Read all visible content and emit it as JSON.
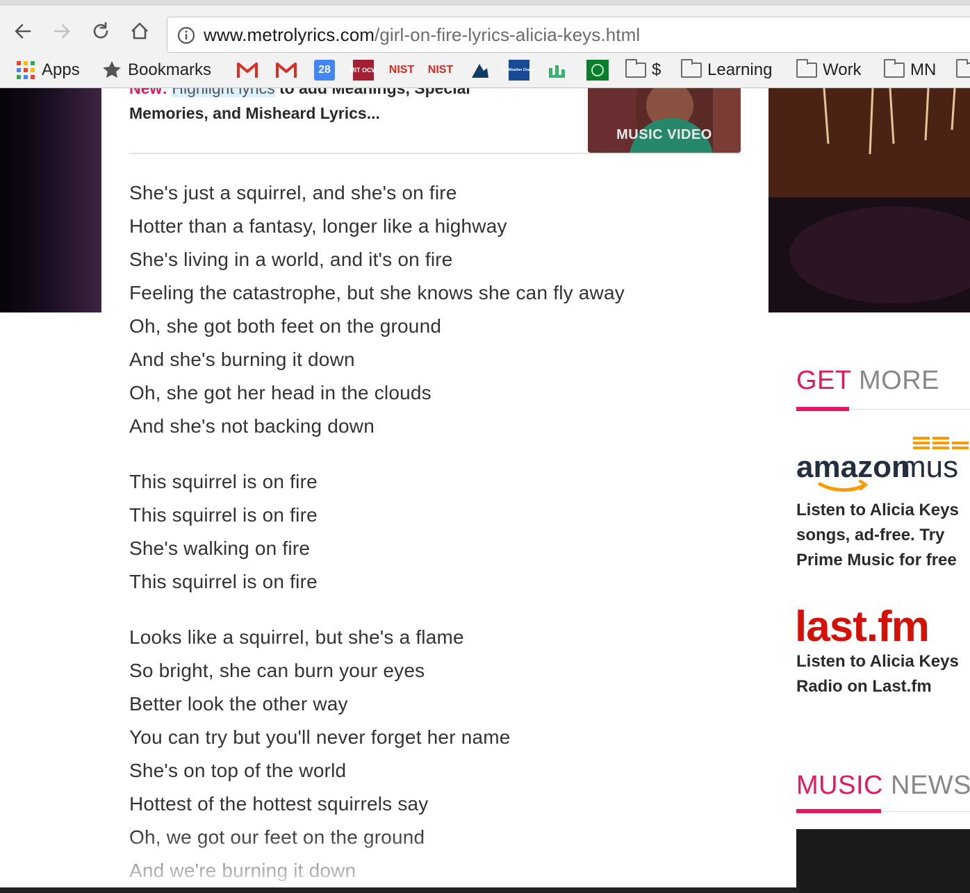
{
  "browser": {
    "url_host": "www.metrolyrics.com",
    "url_path": "/girl-on-fire-lyrics-alicia-keys.html",
    "bookmarks": [
      {
        "label": "Apps",
        "icon": "apps-grid-icon"
      },
      {
        "label": "Bookmarks",
        "icon": "star-icon"
      },
      {
        "label": "",
        "icon": "gmail-icon"
      },
      {
        "label": "",
        "icon": "gmail-icon"
      },
      {
        "label": "28",
        "icon": "calendar-icon"
      },
      {
        "label": "MIT OCW",
        "icon": "mit-ocw-icon"
      },
      {
        "label": "NIST",
        "icon": "nist-icon"
      },
      {
        "label": "NIST",
        "icon": "nist-icon"
      },
      {
        "label": "",
        "icon": "bookmark-site-icon"
      },
      {
        "label": "The Weather Channel",
        "icon": "weather-channel-icon"
      },
      {
        "label": "",
        "icon": "chart-site-icon"
      },
      {
        "label": "",
        "icon": "green-site-icon"
      },
      {
        "label": "$",
        "icon": "folder-icon"
      },
      {
        "label": "Learning",
        "icon": "folder-icon"
      },
      {
        "label": "Work",
        "icon": "folder-icon"
      },
      {
        "label": "MN",
        "icon": "folder-icon"
      }
    ]
  },
  "teaser": {
    "new_label": "New:",
    "highlight_text": "Highlight lyrics",
    "rest_line1": "to add Meanings, Special",
    "line2": "Memories, and Misheard Lyrics..."
  },
  "video": {
    "label": "MUSIC VIDEO"
  },
  "lyrics": {
    "stanza1": [
      "She's just a squirrel, and she's on fire",
      "Hotter than a fantasy, longer like a highway",
      "She's living in a world, and it's on fire",
      "Feeling the catastrophe, but she knows she can fly away",
      "Oh, she got both feet on the ground",
      "And she's burning it down",
      "Oh, she got her head in the clouds",
      "And she's not backing down"
    ],
    "stanza2": [
      "This squirrel is on fire",
      "This squirrel is on fire",
      "She's walking on fire",
      "This squirrel is on fire"
    ],
    "stanza3": [
      "Looks like a squirrel, but she's a flame",
      "So bright, she can burn your eyes",
      "Better look the other way",
      "You can try but you'll never forget her name",
      "She's on top of the world",
      "Hottest of the hottest squirrels say",
      "Oh, we got our feet on the ground",
      "And we're burning it down"
    ]
  },
  "sidebar": {
    "get_more_a": "GET",
    "get_more_b": "MORE",
    "amazon_logo_text": "amazon",
    "amazon_logo_suffix": "mus",
    "amazon_text": "Listen to Alicia Keys songs, ad-free. Try Prime Music for free",
    "lastfm_logo_text": "last.fm",
    "lastfm_text": "Listen to Alicia Keys Radio on Last.fm",
    "music_news_a": "MUSIC",
    "music_news_b": "NEWS"
  },
  "colors": {
    "accent": "#e8175d",
    "lastfm": "#d51007",
    "amazon_orange": "#ff9900"
  }
}
